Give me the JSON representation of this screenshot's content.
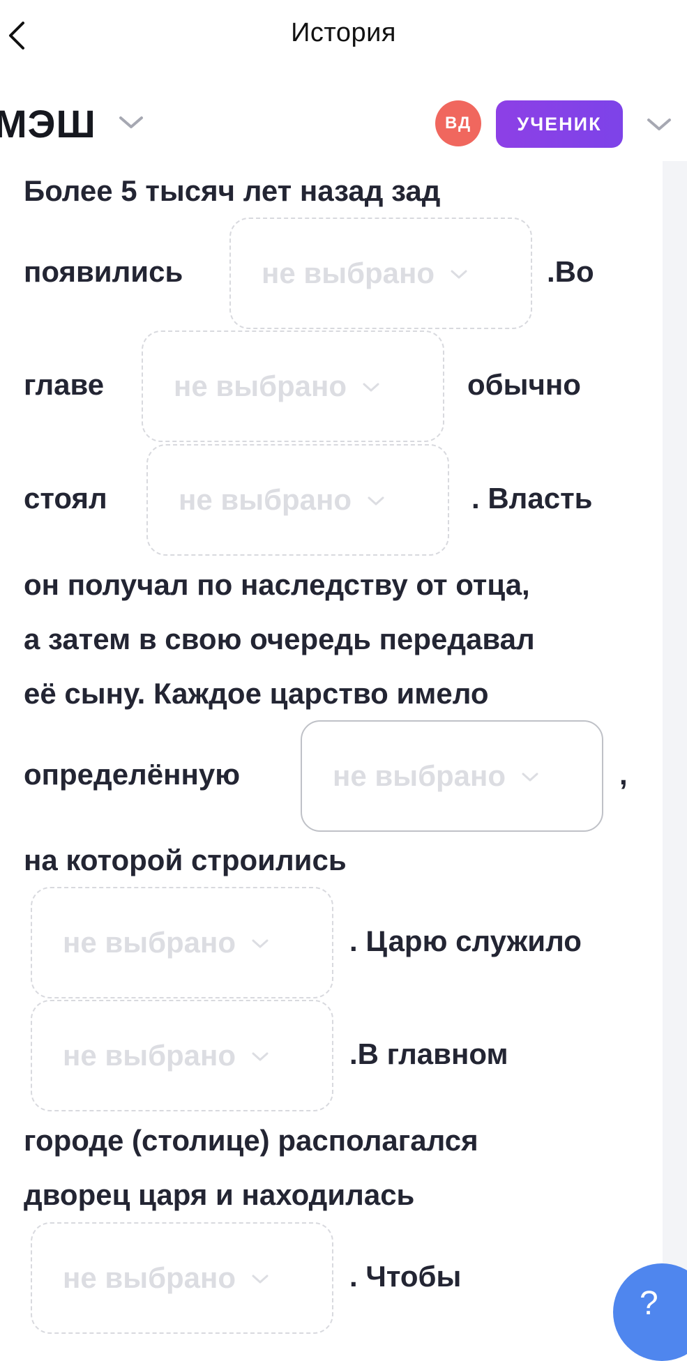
{
  "topbar": {
    "title": "История",
    "back_icon": "chevron-left-icon"
  },
  "header": {
    "logo": "МЭШ",
    "avatar_initials": "ВД",
    "role_badge": "УЧЕНИК",
    "colors": {
      "avatar": "#f0675e",
      "badge": "#8d40e6"
    }
  },
  "exercise": {
    "dropdown_placeholder": "не выбрано",
    "segments": {
      "s1": "Более 5 тысяч лет назад зад",
      "s2": "появились",
      "s3": ".Во",
      "s4": "главе",
      "s5": "обычно",
      "s6": "стоял",
      "s7": ". Власть",
      "s8": "он получал по наследству от отца,",
      "s9": "а затем в свою очередь передавал",
      "s10": "её сыну. Каждое царство имело",
      "s11": "определённую",
      "s12": ",",
      "s13": "на которой строились",
      "s14": ". Царю служило",
      "s15": ".В главном",
      "s16": "городе (столице) располагался",
      "s17": "дворец царя и находилась",
      "s18": ". Чтобы"
    }
  },
  "help_button": {
    "label": "?"
  }
}
